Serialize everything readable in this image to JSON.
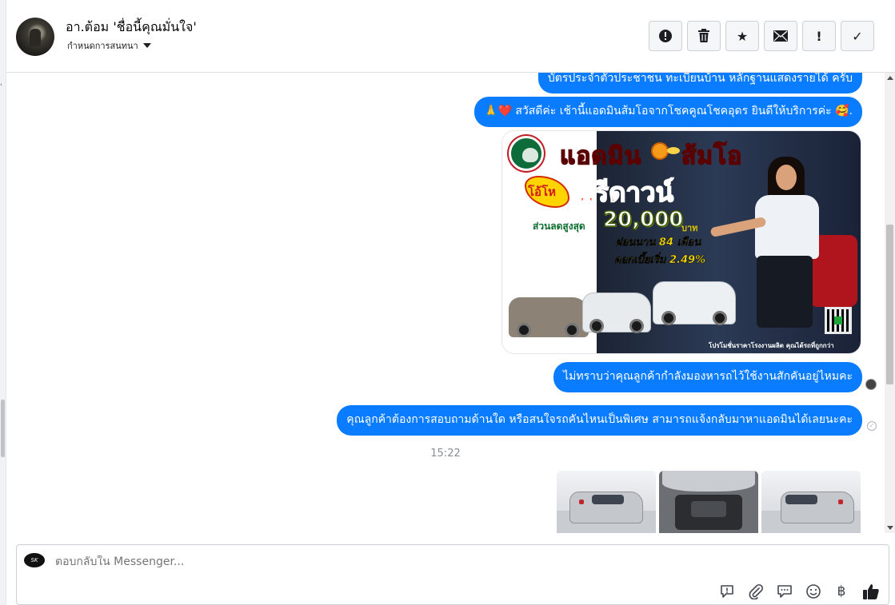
{
  "header": {
    "name": "อา.ต้อม 'ชื่อนี้คุณมั่นใจ'",
    "subtitle": "กำหนดการสนทนา",
    "actions": [
      {
        "name": "report-button",
        "icon": "exclamation-circle-icon",
        "glyph": "!"
      },
      {
        "name": "delete-button",
        "icon": "trash-icon",
        "glyph": ""
      },
      {
        "name": "star-button",
        "icon": "star-icon",
        "glyph": "★"
      },
      {
        "name": "mark-unread-button",
        "icon": "envelope-icon",
        "glyph": "✉"
      },
      {
        "name": "spam-button",
        "icon": "exclamation-icon",
        "glyph": "!"
      },
      {
        "name": "done-button",
        "icon": "check-icon",
        "glyph": "✓"
      }
    ]
  },
  "conversation": {
    "messages": [
      "บัตรประจำตัวประชาชน ทะเบียนบ้าน หลักฐานแสดงรายได้ ครับ",
      "🙏❤️ สวัสดีค่ะ เช้านี้แอดมินส้มโอจากโชคคูณโชคอุดร ยินดีให้บริการค่ะ 🥰.",
      "ไม่ทราบว่าคุณลูกค้ากำลังมองหารถไว้ใช้งานสักคันอยู่ไหมคะ",
      "คุณลูกค้าต้องการสอบถามด้านใด หรือสนใจรถคันไหนเป็นพิเศษ สามารถแจ้งกลับมาหาแอดมินได้เลยนะคะ"
    ],
    "timestamp": "15:22",
    "promo": {
      "title": "แอดมิน",
      "title2": "ส้มโอ",
      "burst": "โอ้โห",
      "headline": "ฟรีดาวน์",
      "discount_label": "ส่วนลดสูงสุด",
      "discount_value": "20,000",
      "discount_unit": "บาท",
      "installment": "ผ่อนนาน 84 เดือน",
      "interest": "ดอกเบี้ยเริ่ม 2.49%",
      "footer": "โปรโมชั่นราคาโรงงานผลิต คุณได้รถที่ถูกกว่า"
    },
    "thumbnails": [
      "truck-front-photo",
      "engine-bay-photo",
      "truck-side-photo"
    ]
  },
  "composer": {
    "avatar_text": "SK",
    "placeholder": "ตอบกลับใน Messenger...",
    "tools": [
      {
        "name": "saved-reply-button",
        "icon": "chat-exclamation-icon",
        "glyph": "💬"
      },
      {
        "name": "attach-button",
        "icon": "paperclip-icon",
        "glyph": "📎"
      },
      {
        "name": "quick-reply-button",
        "icon": "chat-bubble-icon",
        "glyph": "🗨"
      },
      {
        "name": "emoji-button",
        "icon": "smiley-icon",
        "glyph": "☺"
      },
      {
        "name": "payment-button",
        "icon": "baht-icon",
        "glyph": "฿"
      },
      {
        "name": "like-button",
        "icon": "thumbs-up-icon",
        "glyph": "👍"
      }
    ]
  },
  "colors": {
    "bubble": "#0a7cff",
    "timestamp": "#8a8d91",
    "border": "#ccd0d5"
  }
}
